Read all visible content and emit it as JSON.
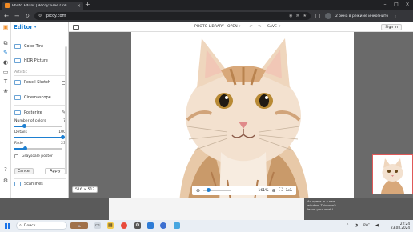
{
  "browser": {
    "tab_title": "Photo Editor | iPiccy: Free Onli…",
    "tab_close": "×",
    "new_tab": "+",
    "url": "ipiccy.com",
    "incognito_label": "2 окна в режиме инкогнито",
    "window_controls": {
      "minimize": "–",
      "maximize": "□",
      "close": "×"
    }
  },
  "sidebar": {
    "brand": "Editor",
    "items": {
      "color_tint": "Color Tint",
      "hdr_picture": "HDR Picture",
      "section_artistic": "Artistic",
      "pencil_sketch": "Pencil Sketch",
      "cinemascope": "Cinemascope",
      "posterize": "Posterize",
      "scanlines": "Scanlines"
    },
    "posterize": {
      "number_of_colors_label": "Number of colors",
      "number_of_colors_value": "7",
      "details_label": "Details",
      "details_value": "100",
      "fade_label": "Fade",
      "fade_value": "23",
      "grayscale_label": "Grayscale poster",
      "cancel_label": "Cancel",
      "apply_label": "Apply",
      "number_of_colors_fraction": 0.2,
      "details_fraction": 1.0,
      "fade_fraction": 0.23
    }
  },
  "toolbar": {
    "photo_library": "PHOTO LIBRARY",
    "open": "OPEN",
    "save": "SAVE",
    "sign_in": "Sign In"
  },
  "canvas": {
    "dimensions": "516 × 513",
    "zoom": "161%",
    "ratio": "1:1"
  },
  "ad": {
    "note": "Ad opens in a new window. This won't leave your work!"
  },
  "taskbar": {
    "search_placeholder": "Поиск",
    "time": "22:24",
    "date": "23.08.2024",
    "lang": "РУС"
  },
  "colors": {
    "accent": "#1d7fd1",
    "chrome_dark": "#202124",
    "chrome_bar": "#35363a",
    "workspace": "#6a6a6a"
  }
}
